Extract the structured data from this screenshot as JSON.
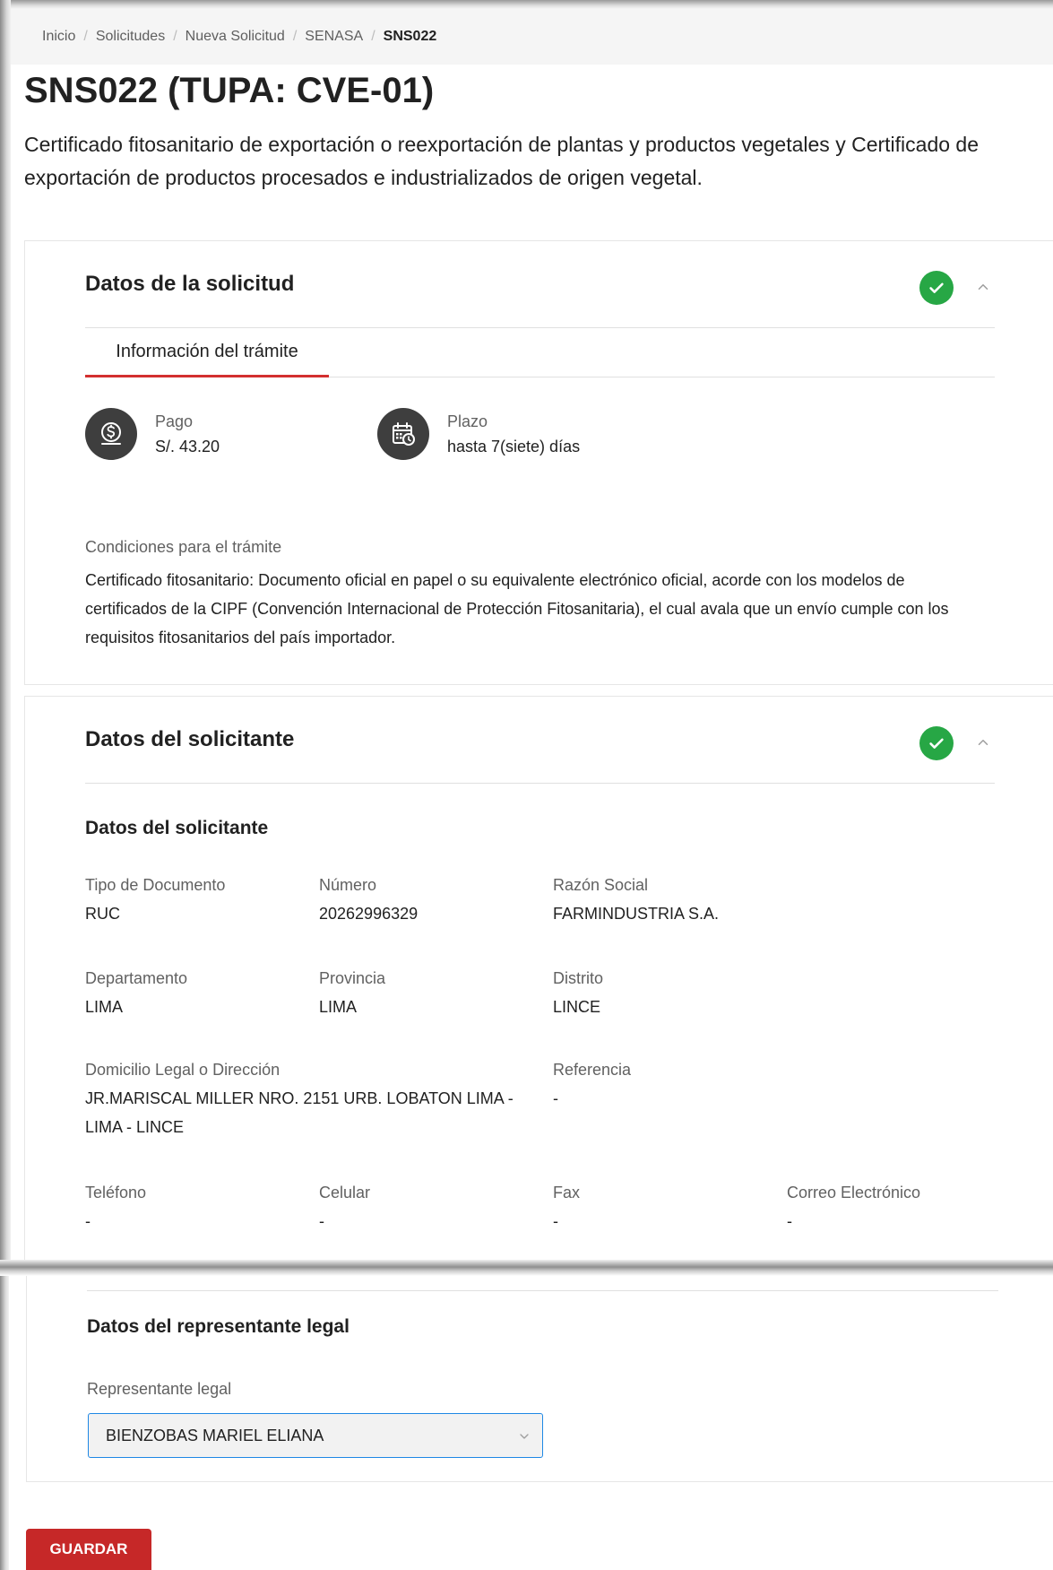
{
  "breadcrumb": [
    "Inicio",
    "Solicitudes",
    "Nueva Solicitud",
    "SENASA",
    "SNS022"
  ],
  "page": {
    "code": "SNS022",
    "tupa": "(TUPA: CVE-01)",
    "description": "Certificado fitosanitario de exportación o reexportación de plantas y productos vegetales y Certificado de exportación de productos procesados e industrializados de origen vegetal."
  },
  "solicitud": {
    "title": "Datos de la solicitud",
    "tab_label": "Información del trámite",
    "pago_label": "Pago",
    "pago_value": "S/. 43.20",
    "plazo_label": "Plazo",
    "plazo_value": "hasta 7(siete) días",
    "conditions_label": "Condiciones para el trámite",
    "conditions_text": "Certificado fitosanitario: Documento oficial en papel o su equivalente electrónico oficial, acorde con los modelos de certificados de la CIPF (Convención Internacional de Protección Fitosanitaria), el cual avala que un envío cumple con los requisitos fitosanitarios del país importador."
  },
  "solicitante": {
    "title": "Datos del solicitante",
    "subtitle": "Datos del solicitante",
    "fields": {
      "tipo_documento": {
        "label": "Tipo de Documento",
        "value": "RUC"
      },
      "numero": {
        "label": "Número",
        "value": "20262996329"
      },
      "razon_social": {
        "label": "Razón Social",
        "value": "FARMINDUSTRIA S.A."
      },
      "departamento": {
        "label": "Departamento",
        "value": "LIMA"
      },
      "provincia": {
        "label": "Provincia",
        "value": "LIMA"
      },
      "distrito": {
        "label": "Distrito",
        "value": "LINCE"
      },
      "domicilio": {
        "label": "Domicilio Legal o Dirección",
        "value": "JR.MARISCAL MILLER NRO. 2151 URB. LOBATON LIMA - LIMA - LINCE"
      },
      "referencia": {
        "label": "Referencia",
        "value": "-"
      },
      "telefono": {
        "label": "Teléfono",
        "value": "-"
      },
      "celular": {
        "label": "Celular",
        "value": "-"
      },
      "fax": {
        "label": "Fax",
        "value": "-"
      },
      "correo": {
        "label": "Correo Electrónico",
        "value": "-"
      }
    }
  },
  "representante": {
    "subtitle": "Datos del representante legal",
    "select_label": "Representante legal",
    "select_value": "BIENZOBAS MARIEL ELIANA"
  },
  "actions": {
    "save_label": "GUARDAR"
  },
  "colors": {
    "accent": "#c62828",
    "success": "#27a745",
    "focus_border": "#1e88e5"
  },
  "icons": [
    "check-circle-icon",
    "chevron-up-icon",
    "dollar-coin-icon",
    "calendar-clock-icon",
    "chevron-down-icon"
  ]
}
